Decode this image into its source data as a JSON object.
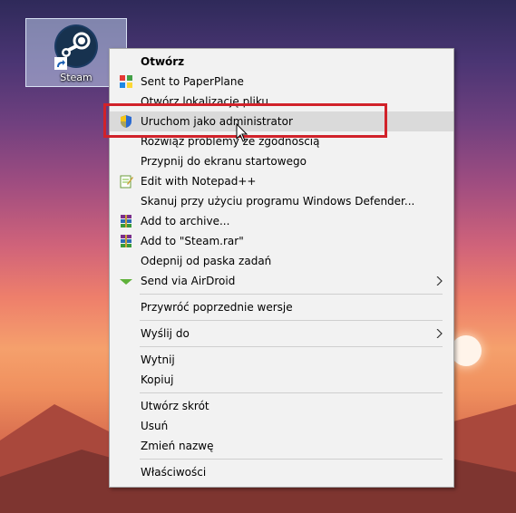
{
  "desktop": {
    "icon": {
      "label": "Steam",
      "icon": "steam-icon"
    }
  },
  "context_menu": {
    "items": [
      {
        "label": "Otwórz",
        "bold": true
      },
      {
        "label": "Sent to PaperPlane",
        "icon": "paperplane-icon"
      },
      {
        "label": "Otwórz lokalizację pliku"
      },
      {
        "label": "Uruchom jako administrator",
        "icon": "uac-shield-icon",
        "highlighted": true
      },
      {
        "label": "Rozwiąż problemy ze zgodnością"
      },
      {
        "label": "Przypnij do ekranu startowego"
      },
      {
        "label": "Edit with Notepad++",
        "icon": "notepadpp-icon"
      },
      {
        "label": "Skanuj przy użyciu programu Windows Defender..."
      },
      {
        "label": "Add to archive...",
        "icon": "winrar-icon"
      },
      {
        "label": "Add to \"Steam.rar\"",
        "icon": "winrar-icon"
      },
      {
        "label": "Odepnij od paska zadań"
      },
      {
        "label": "Send via AirDroid",
        "icon": "airdroid-icon",
        "submenu": true
      },
      {
        "label": "Przywróć poprzednie wersje"
      },
      {
        "label": "Wyślij do",
        "submenu": true
      },
      {
        "label": "Wytnij"
      },
      {
        "label": "Kopiuj"
      },
      {
        "label": "Utwórz skrót"
      },
      {
        "label": "Usuń"
      },
      {
        "label": "Zmień nazwę"
      },
      {
        "label": "Właściwości"
      }
    ]
  },
  "colors": {
    "highlight_box": "#d1222a",
    "menu_bg": "#f2f2f2",
    "hover_bg": "#dadada"
  }
}
